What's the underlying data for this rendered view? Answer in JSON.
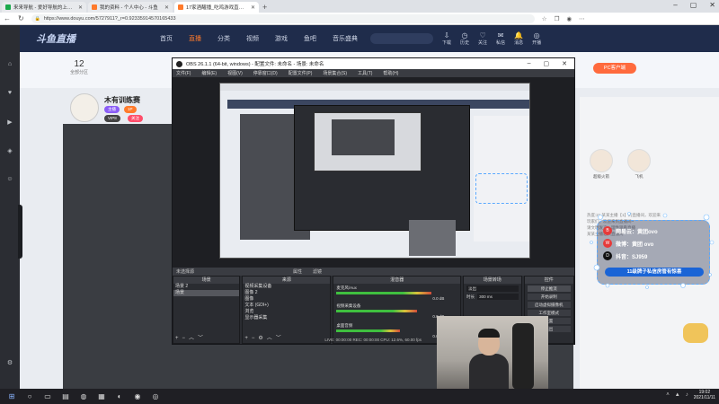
{
  "browser": {
    "tabs": [
      {
        "label": "来来导航 - 爱好导航的上网导航",
        "favcolor": "#1aa94c",
        "active": false
      },
      {
        "label": "我的资料 - 个人中心 - 斗鱼",
        "favcolor": "#ff7a2b",
        "active": false
      },
      {
        "label": "17家酒醒播_吃鸡游戏直播_斗鱼",
        "favcolor": "#ff7a2b",
        "active": true
      }
    ],
    "url": "https://www.douyu.com/5727911?_r=0.92335914570165433"
  },
  "site": {
    "logo": "斗鱼直播",
    "nav": [
      "首页",
      "直播",
      "分类",
      "视频",
      "游戏",
      "鱼吧",
      "音乐盛典"
    ],
    "header_icons": [
      "下载",
      "历史",
      "关注",
      "私信",
      "消息",
      "开播"
    ],
    "rank_num": "12",
    "rank_label": "全部分区",
    "pc_button": "PC客户端",
    "host_name": "木有训练赛",
    "host_badges": [
      "主播",
      "1P",
      "VIP8",
      "关注"
    ],
    "gifts": [
      "超级火箭",
      "飞机"
    ],
    "chat_lines": [
      "热度:21 某某主播【1】的直播间，欢迎来",
      "玩家们，欢迎来到直播间~",
      "请文明发言，理性观看直播",
      "某某主播进入直播间"
    ]
  },
  "social": {
    "rows": [
      {
        "icon": "B",
        "text": "网易云：黄团ovo"
      },
      {
        "icon": "W",
        "text": "微博：黄团 ovo"
      },
      {
        "icon": "D",
        "text": "抖音：SJ959"
      }
    ],
    "banner": "11级牌子私信房管有惊喜"
  },
  "obs": {
    "title": "OBS 26.1.1 (64-bit, windows) - 配置文件: 未命名 - 场景: 未命名",
    "menu": [
      "文件(F)",
      "编辑(E)",
      "视图(V)",
      "停靠窗口(D)",
      "配置文件(P)",
      "场景集合(S)",
      "工具(T)",
      "帮助(H)"
    ],
    "source_hint": "未选择源",
    "bar_tabs": [
      "属性",
      "滤镜"
    ],
    "docks": {
      "scenes_title": "场景",
      "scenes": [
        "场景 2",
        "场景"
      ],
      "sources_title": "来源",
      "sources": [
        "视频采集设备",
        "图像 2",
        "图像",
        "文本 (GDI+)",
        "浏览",
        "显示器采集"
      ],
      "mixer_title": "混音器",
      "mixer": [
        {
          "name": "麦克风/Aux",
          "level": "0.0 dB",
          "fill": 0.78
        },
        {
          "name": "视频采集设备",
          "level": "0.0 dB",
          "fill": 0.66
        },
        {
          "name": "桌面音频",
          "level": "0.0 dB",
          "fill": 0.52
        }
      ],
      "transitions_title": "场景转场",
      "transition": "淡出",
      "duration_label": "时长",
      "duration": "300 ms",
      "controls_title": "控件",
      "controls": [
        "停止推流",
        "开始录制",
        "启动虚拟摄像机",
        "工作室模式",
        "设置",
        "退出"
      ]
    },
    "status": "LIVE: 00:00:00  REC: 00:00:00  CPU: 12.6%, 60.00 fps"
  },
  "taskbar": {
    "time": "19:02",
    "date": "2021/11/11"
  }
}
